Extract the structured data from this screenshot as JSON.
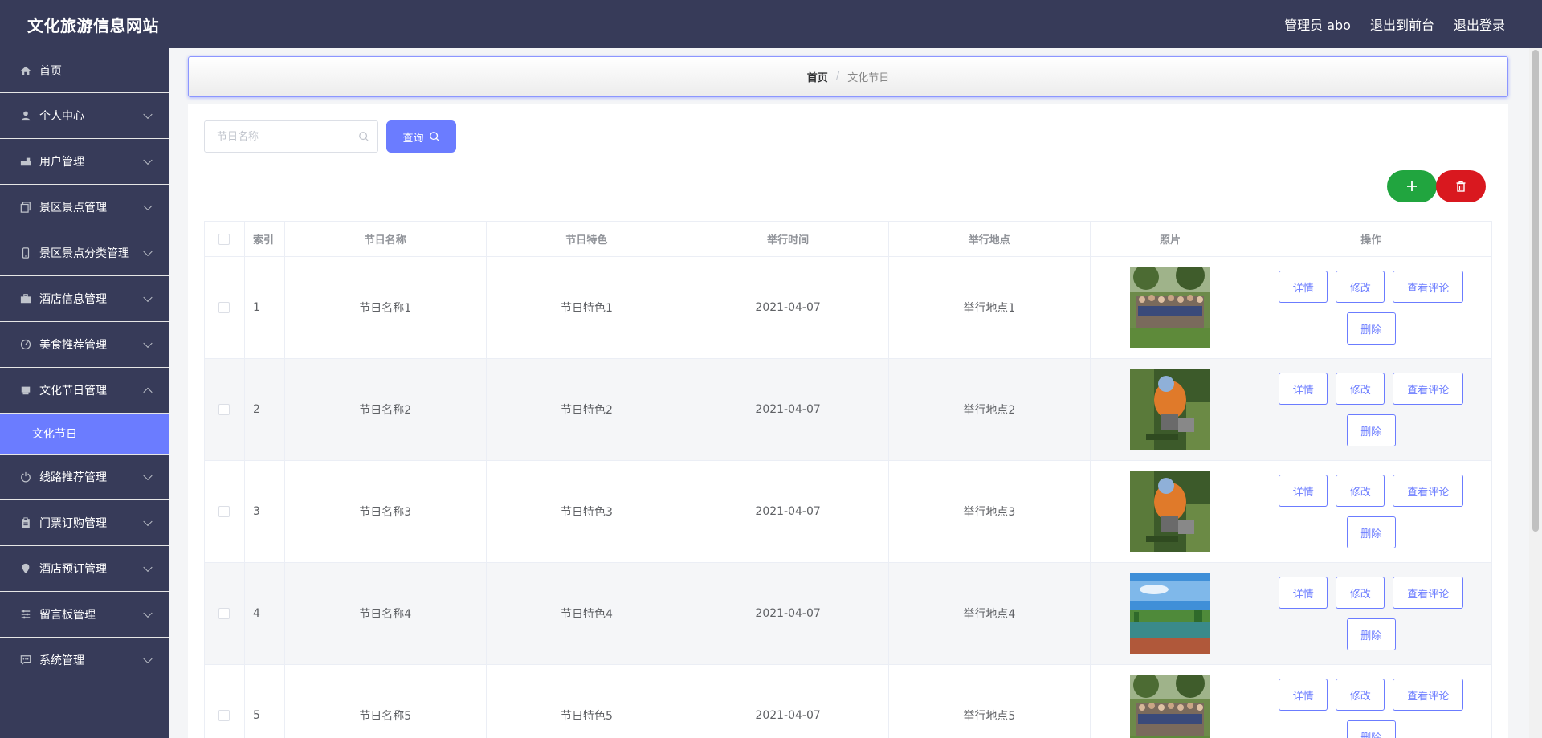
{
  "header": {
    "site_title": "文化旅游信息网站",
    "admin_label": "管理员 abo",
    "to_frontend": "退出到前台",
    "logout": "退出登录"
  },
  "sidebar": {
    "items": [
      {
        "label": "首页",
        "icon": "home-icon"
      },
      {
        "label": "个人中心",
        "icon": "user-icon"
      },
      {
        "label": "用户管理",
        "icon": "users-icon"
      },
      {
        "label": "景区景点管理",
        "icon": "copy-icon"
      },
      {
        "label": "景区景点分类管理",
        "icon": "mobile-icon"
      },
      {
        "label": "酒店信息管理",
        "icon": "briefcase-icon"
      },
      {
        "label": "美食推荐管理",
        "icon": "gauge-icon"
      },
      {
        "label": "文化节日管理",
        "icon": "printer-icon"
      },
      {
        "label": "线路推荐管理",
        "icon": "power-icon"
      },
      {
        "label": "门票订购管理",
        "icon": "clipboard-icon"
      },
      {
        "label": "酒店预订管理",
        "icon": "location-icon"
      },
      {
        "label": "留言板管理",
        "icon": "list-icon"
      },
      {
        "label": "系统管理",
        "icon": "chat-icon"
      }
    ],
    "active_sub": "文化节日"
  },
  "breadcrumb": {
    "home": "首页",
    "separator": "/",
    "current": "文化节日"
  },
  "search": {
    "placeholder": "节日名称",
    "query_label": "查询"
  },
  "table": {
    "headers": [
      "索引",
      "节日名称",
      "节日特色",
      "举行时间",
      "举行地点",
      "照片",
      "操作"
    ],
    "rows": [
      {
        "index": "1",
        "name": "节日名称1",
        "feature": "节日特色1",
        "time": "2021-04-07",
        "place": "举行地点1",
        "photo": "group-photo"
      },
      {
        "index": "2",
        "name": "节日名称2",
        "feature": "节日特色2",
        "time": "2021-04-07",
        "place": "举行地点2",
        "photo": "worker-photo"
      },
      {
        "index": "3",
        "name": "节日名称3",
        "feature": "节日特色3",
        "time": "2021-04-07",
        "place": "举行地点3",
        "photo": "worker-photo"
      },
      {
        "index": "4",
        "name": "节日名称4",
        "feature": "节日特色4",
        "time": "2021-04-07",
        "place": "举行地点4",
        "photo": "lake-photo"
      },
      {
        "index": "5",
        "name": "节日名称5",
        "feature": "节日特色5",
        "time": "2021-04-07",
        "place": "举行地点5",
        "photo": "group-photo"
      }
    ],
    "actions": {
      "detail": "详情",
      "edit": "修改",
      "comments": "查看评论",
      "delete": "删除"
    }
  },
  "colors": {
    "header_bg": "#373b59",
    "accent": "#6b7cff",
    "add_green": "#21a53f",
    "delete_red": "#d9181f"
  }
}
